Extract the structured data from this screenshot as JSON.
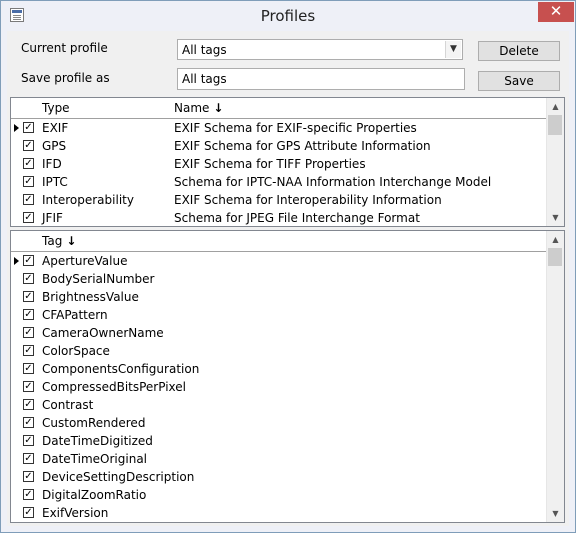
{
  "window": {
    "title": "Profiles",
    "close_label": "✕"
  },
  "form": {
    "current_profile_label": "Current profile",
    "current_profile_value": "All tags",
    "save_profile_label": "Save profile as",
    "save_profile_value": "All tags",
    "delete_label": "Delete",
    "save_label": "Save"
  },
  "types_grid": {
    "col_type": "Type",
    "col_name": "Name",
    "sort_indicator": "↓",
    "rows": [
      {
        "type": "EXIF",
        "name": "EXIF Schema for EXIF-specific Properties",
        "checked": true,
        "current": true
      },
      {
        "type": "GPS",
        "name": "EXIF Schema for GPS Attribute Information",
        "checked": true,
        "current": false
      },
      {
        "type": "IFD",
        "name": "EXIF Schema for TIFF Properties",
        "checked": true,
        "current": false
      },
      {
        "type": "IPTC",
        "name": "Schema for IPTC-NAA Information Interchange Model",
        "checked": true,
        "current": false
      },
      {
        "type": "Interoperability",
        "name": "EXIF Schema for Interoperability Information",
        "checked": true,
        "current": false
      },
      {
        "type": "JFIF",
        "name": "Schema for JPEG File Interchange Format",
        "checked": true,
        "current": false
      }
    ]
  },
  "tags_grid": {
    "col_tag": "Tag",
    "sort_indicator": "↓",
    "rows": [
      {
        "tag": "ApertureValue",
        "checked": true,
        "current": true
      },
      {
        "tag": "BodySerialNumber",
        "checked": true,
        "current": false
      },
      {
        "tag": "BrightnessValue",
        "checked": true,
        "current": false
      },
      {
        "tag": "CFAPattern",
        "checked": true,
        "current": false
      },
      {
        "tag": "CameraOwnerName",
        "checked": true,
        "current": false
      },
      {
        "tag": "ColorSpace",
        "checked": true,
        "current": false
      },
      {
        "tag": "ComponentsConfiguration",
        "checked": true,
        "current": false
      },
      {
        "tag": "CompressedBitsPerPixel",
        "checked": true,
        "current": false
      },
      {
        "tag": "Contrast",
        "checked": true,
        "current": false
      },
      {
        "tag": "CustomRendered",
        "checked": true,
        "current": false
      },
      {
        "tag": "DateTimeDigitized",
        "checked": true,
        "current": false
      },
      {
        "tag": "DateTimeOriginal",
        "checked": true,
        "current": false
      },
      {
        "tag": "DeviceSettingDescription",
        "checked": true,
        "current": false
      },
      {
        "tag": "DigitalZoomRatio",
        "checked": true,
        "current": false
      },
      {
        "tag": "ExifVersion",
        "checked": true,
        "current": false
      }
    ]
  },
  "icons": {
    "app": "app-window-icon",
    "close": "close-icon",
    "dropdown": "chevron-down-icon",
    "check": "checkmark-icon",
    "row_pointer": "row-pointer-icon",
    "scroll_up": "scroll-up-icon",
    "scroll_down": "scroll-down-icon"
  },
  "colors": {
    "close_button": "#c7504f",
    "frame": "#eef0f7",
    "content": "#f0f0f0"
  }
}
